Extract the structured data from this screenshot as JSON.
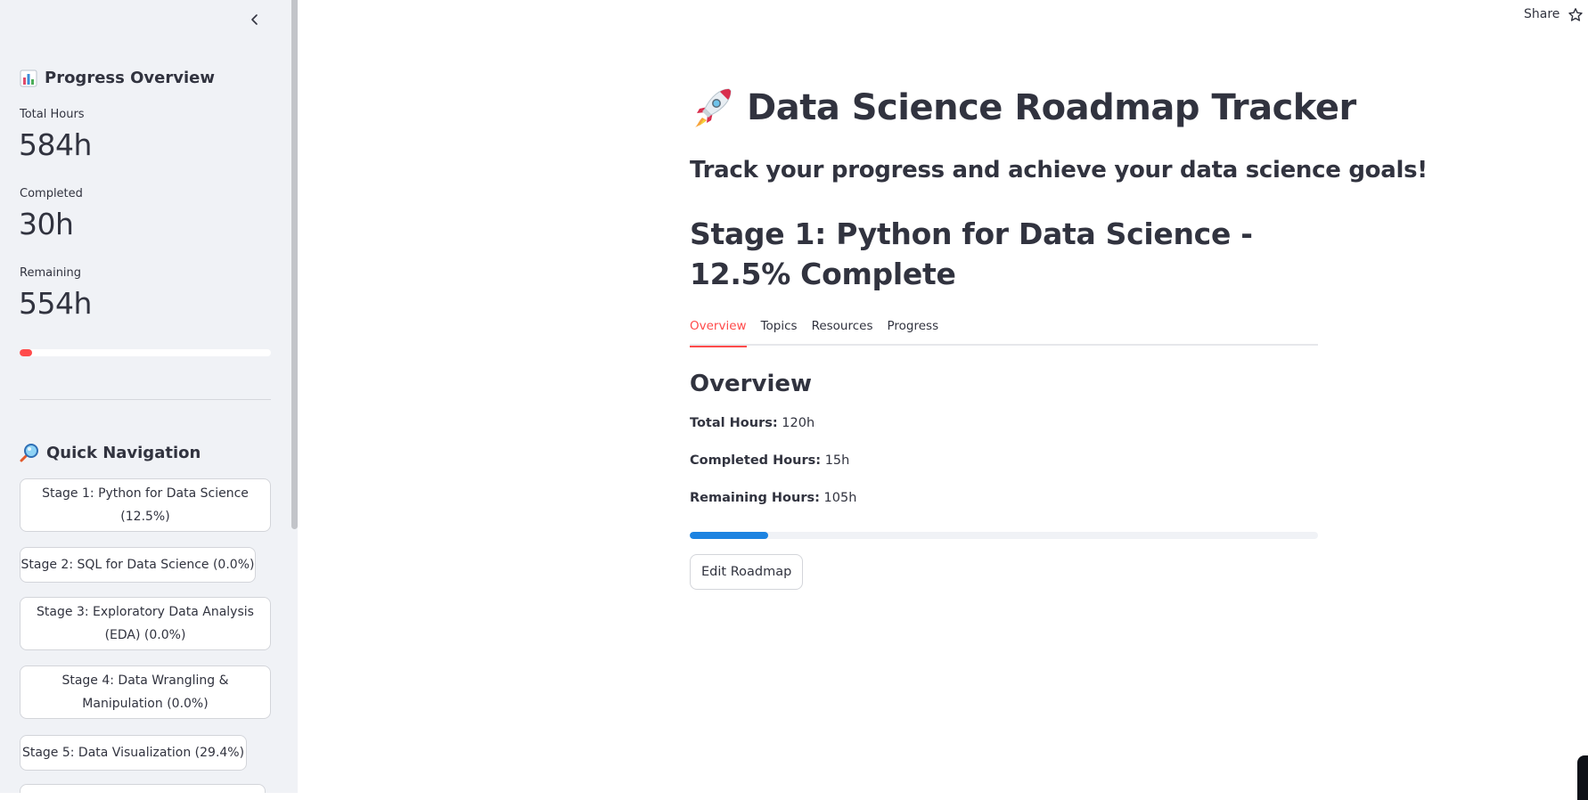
{
  "sidebar": {
    "progress_title": "Progress Overview",
    "progress_icon": "bar-chart-icon",
    "metrics": [
      {
        "label": "Total Hours",
        "value": "584h"
      },
      {
        "label": "Completed",
        "value": "30h"
      },
      {
        "label": "Remaining",
        "value": "554h"
      }
    ],
    "overall_progress_fraction": 0.05,
    "nav_title": "Quick Navigation",
    "nav_icon": "magnifying-glass-icon",
    "nav_items": [
      {
        "label": "Stage 1: Python for Data Science (12.5%)"
      },
      {
        "label": "Stage 2: SQL for Data Science (0.0%)"
      },
      {
        "label": "Stage 3: Exploratory Data Analysis (EDA) (0.0%)"
      },
      {
        "label": "Stage 4: Data Wrangling & Manipulation (0.0%)"
      },
      {
        "label": "Stage 5: Data Visualization (29.4%)"
      }
    ]
  },
  "header": {
    "share_label": "Share",
    "star_icon": "star-icon"
  },
  "main": {
    "title": "Data Science Roadmap Tracker",
    "title_icon": "rocket-icon",
    "subtitle": "Track your progress and achieve your data science goals!",
    "stage_heading": "Stage 1: Python for Data Science - 12.5% Complete",
    "tabs": [
      {
        "label": "Overview",
        "active": true
      },
      {
        "label": "Topics",
        "active": false
      },
      {
        "label": "Resources",
        "active": false
      },
      {
        "label": "Progress",
        "active": false
      }
    ],
    "overview": {
      "heading": "Overview",
      "total_label": "Total Hours:",
      "total_value": "120h",
      "completed_label": "Completed Hours:",
      "completed_value": "15h",
      "remaining_label": "Remaining Hours:",
      "remaining_value": "105h",
      "progress_fraction": 0.125
    },
    "edit_button_label": "Edit Roadmap"
  },
  "colors": {
    "accent": "#ff4b4b",
    "progress_blue": "#1c83e1",
    "sidebar_bg": "#f0f2f6",
    "text": "#31333f"
  }
}
